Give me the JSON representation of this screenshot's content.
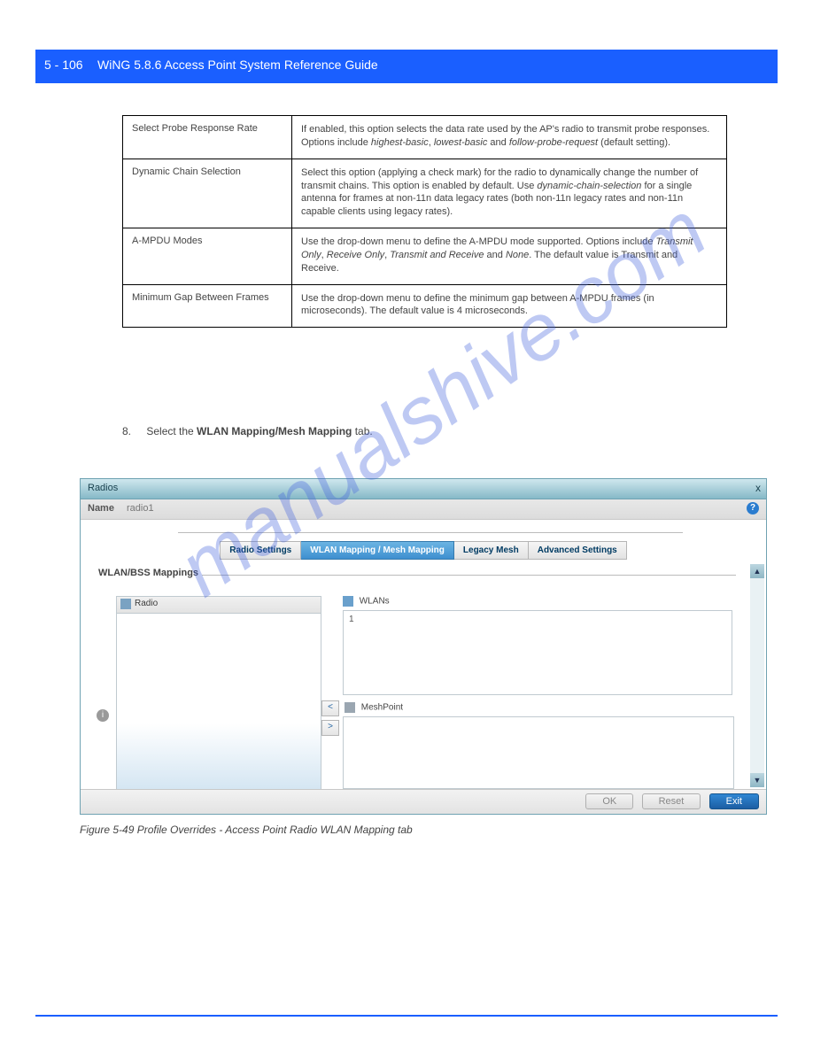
{
  "header": {
    "page_number": "5 - 106",
    "product": "WiNG 5.8.6 Access Point System Reference Guide"
  },
  "table": {
    "rows": [
      {
        "name": "Select Probe Response Rate",
        "desc_parts": [
          "If enabled, this option selects the data rate used by the AP's radio to transmit probe responses. Options include ",
          "highest-basic",
          ", ",
          "lowest-basic",
          " and ",
          "follow-probe-request",
          " (default setting)."
        ]
      },
      {
        "name": "Dynamic Chain Selection",
        "desc_parts": [
          "Select this option (applying a check mark) for the radio to dynamically change the number of transmit chains. This option is enabled by default. Use ",
          "dynamic-chain-selection",
          " for a single antenna for frames at non-11n data legacy rates (both non-11n legacy rates and non-11n capable clients using legacy rates)."
        ]
      },
      {
        "name": "A-MPDU Modes",
        "desc_parts": [
          "Use the drop-down menu to define the A-MPDU mode supported. Options include ",
          "Transmit Only",
          ", ",
          "Receive Only",
          ", ",
          "Transmit and Receive",
          " and ",
          "None",
          ". The default value is Transmit and Receive."
        ]
      },
      {
        "name": "Minimum Gap Between Frames",
        "desc_parts": [
          "Use the drop-down menu to define the minimum gap between A-MPDU frames (in microseconds). The default value is 4 microseconds."
        ]
      }
    ]
  },
  "step8": {
    "num": "8.",
    "text_a": "Select the ",
    "bold": "WLAN Mapping/Mesh Mapping",
    "text_b": " tab."
  },
  "dialog": {
    "title": "Radios",
    "name_label": "Name",
    "name_value": "radio1",
    "help": "?",
    "tabs": [
      "Radio Settings",
      "WLAN Mapping / Mesh Mapping",
      "Legacy Mesh",
      "Advanced Settings"
    ],
    "fieldset_label": "WLAN/BSS Mappings",
    "radio_header": "Radio",
    "wlans_label": "WLANs",
    "wlans_initial": "1",
    "mesh_label": "MeshPoint",
    "btn_left": "<",
    "btn_right": ">",
    "close": "x",
    "buttons": {
      "ok": "OK",
      "reset": "Reset",
      "exit": "Exit"
    }
  },
  "figcap": "Figure 5-49 Profile Overrides - Access Point Radio WLAN Mapping tab"
}
